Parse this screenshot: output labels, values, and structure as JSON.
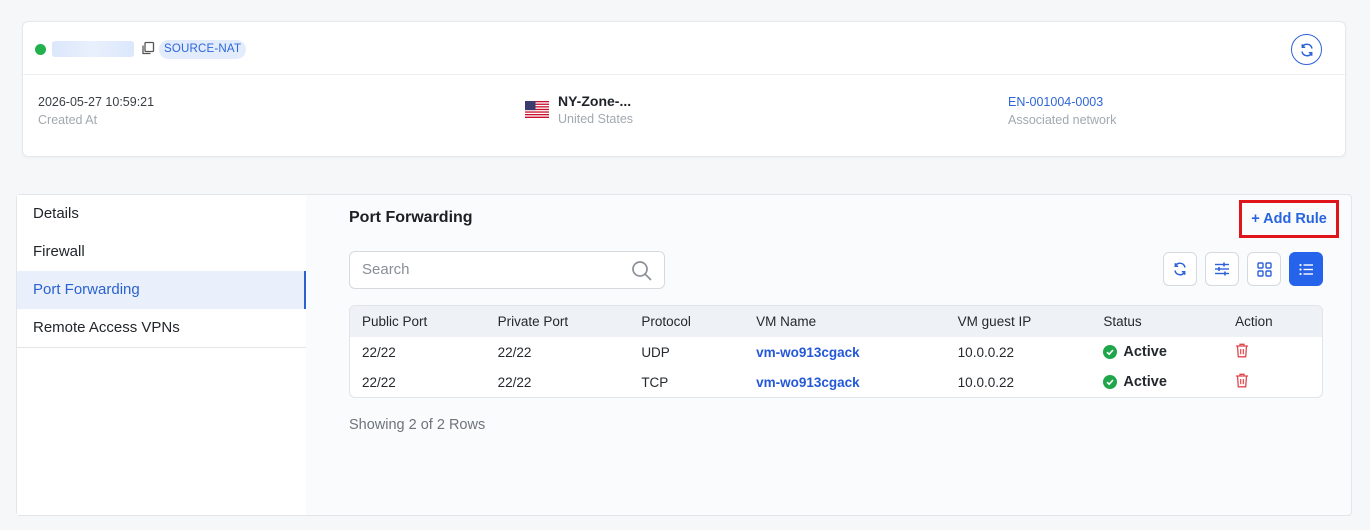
{
  "header": {
    "badge": "SOURCE-NAT",
    "created_value": "2026-05-27 10:59:21",
    "created_label": "Created At",
    "zone_name": "NY-Zone-...",
    "zone_country": "United States",
    "network_value": "EN-001004-0003",
    "network_label": "Associated network"
  },
  "sidebar": {
    "items": [
      {
        "label": "Details"
      },
      {
        "label": "Firewall"
      },
      {
        "label": "Port Forwarding"
      },
      {
        "label": "Remote Access VPNs"
      }
    ],
    "active_index": 2
  },
  "main": {
    "title": "Port Forwarding",
    "add_rule_label": "+ Add Rule",
    "search_placeholder": "Search",
    "table": {
      "columns": [
        "Public Port",
        "Private Port",
        "Protocol",
        "VM Name",
        "VM guest IP",
        "Status",
        "Action"
      ],
      "rows": [
        {
          "public_port": "22/22",
          "private_port": "22/22",
          "protocol": "UDP",
          "vm_name": "vm-wo913cgack",
          "vm_ip": "10.0.0.22",
          "status": "Active"
        },
        {
          "public_port": "22/22",
          "private_port": "22/22",
          "protocol": "TCP",
          "vm_name": "vm-wo913cgack",
          "vm_ip": "10.0.0.22",
          "status": "Active"
        }
      ]
    },
    "row_count_text": "Showing 2 of 2 Rows"
  },
  "colors": {
    "accent": "#2563eb",
    "status_active": "#1fa64a",
    "highlight_border": "#e0141b",
    "delete_icon": "#e0474c"
  },
  "icons": {
    "copy": "copy-icon",
    "refresh": "refresh-icon",
    "search": "search-icon",
    "filter": "sliders-icon",
    "grid_view": "grid-icon",
    "list_view": "list-icon",
    "delete": "trash-icon",
    "status": "check-circle-icon"
  }
}
